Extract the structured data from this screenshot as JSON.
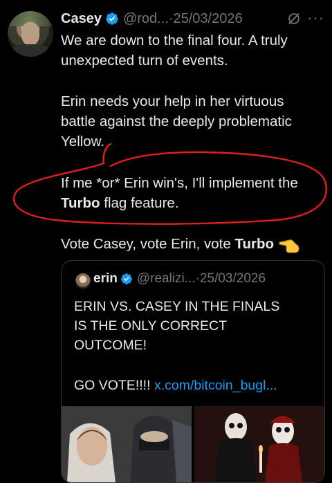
{
  "author": {
    "name": "Casey",
    "handle": "@rod...",
    "separator": "·",
    "date": "25/03/2026"
  },
  "icons": {
    "verified": "verified-badge-icon",
    "grok": "grok-icon",
    "more": "more-icon",
    "pointing": "pointing-hand-emoji"
  },
  "tweet": {
    "paragraph1_line1": "We are down to the final four. A truly",
    "paragraph1_line2": "unexpected turn of events.",
    "paragraph2_line1": "Erin needs your help in her virtuous",
    "paragraph2_line2": "battle against the deeply problematic",
    "paragraph2_line3": "Yellow.",
    "paragraph3_line1": "If me *or* Erin win's, I'll implement the",
    "paragraph3_bold": "Turbo",
    "paragraph3_rest": " flag feature.",
    "paragraph4_text": "Vote Casey, vote Erin, vote ",
    "paragraph4_bold": "Turbo"
  },
  "quote": {
    "name": "erin",
    "handle": "@realizi...",
    "separator": "·",
    "date": "25/03/2026",
    "line1": "ERIN VS. CASEY IN THE FINALS",
    "line2": "IS THE ONLY CORRECT",
    "line3": "OUTCOME!",
    "line4_text": "GO VOTE!!!! ",
    "line4_link": "x.com/bitcoin_bugl..."
  },
  "colors": {
    "background": "#000000",
    "text": "#e7e9ea",
    "muted": "#71767b",
    "verified": "#1d9bf0",
    "link": "#1d9bf0",
    "annotation": "#e0201c"
  }
}
